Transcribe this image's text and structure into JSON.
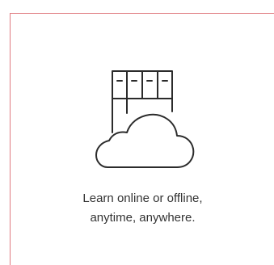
{
  "feature": {
    "icon": "cloud-server-icon",
    "line1": "Learn online or offline,",
    "line2": "anytime, anywhere.",
    "border_color": "#e07a7f",
    "text_color": "#333333",
    "icon_color": "#2b2b2b"
  }
}
